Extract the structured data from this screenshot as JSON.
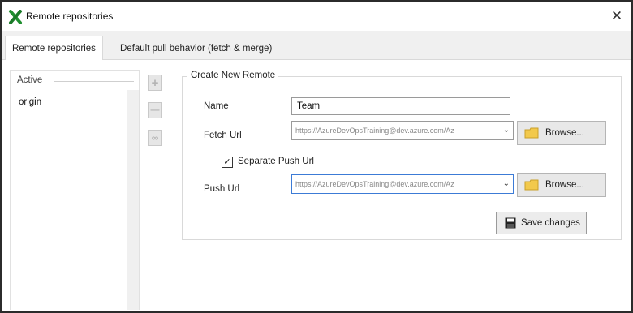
{
  "window": {
    "title": "Remote repositories",
    "close_glyph": "✕"
  },
  "tabs": [
    {
      "label": "Remote repositories",
      "active": true
    },
    {
      "label": "Default pull behavior (fetch & merge)",
      "active": false
    }
  ],
  "remotes_list": {
    "legend": "Active",
    "items": [
      "origin"
    ]
  },
  "side_buttons": [
    {
      "icon": "add-icon",
      "glyph": "+"
    },
    {
      "icon": "remove-icon",
      "glyph": "—"
    },
    {
      "icon": "link-icon",
      "glyph": "∞"
    }
  ],
  "create_remote": {
    "legend": "Create New Remote",
    "name_label": "Name",
    "name_value": "Team",
    "fetch_label": "Fetch Url",
    "fetch_value": "https://AzureDevOpsTraining@dev.azure.com/Az",
    "separate_push_label": "Separate Push Url",
    "separate_push_checked": true,
    "push_label": "Push Url",
    "push_value": "https://AzureDevOpsTraining@dev.azure.com/Az",
    "browse_label": "Browse...",
    "save_label": "Save changes"
  },
  "colors": {
    "app_icon_green": "#1f8f2f",
    "folder_yellow": "#f2c94c",
    "focus_blue": "#3c7bd6"
  }
}
